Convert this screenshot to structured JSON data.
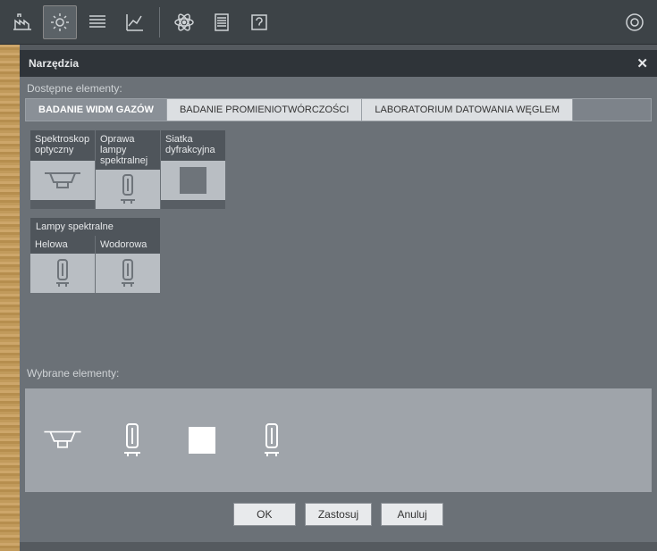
{
  "dialog": {
    "title": "Narzędzia",
    "available_label": "Dostępne elementy:",
    "selected_label": "Wybrane elementy:",
    "tabs": [
      "BADANIE WIDM GAZÓW",
      "BADANIE PROMIENIOTWÓRCZOŚCI",
      "LABORATORIUM DATOWANIA WĘGLEM"
    ],
    "main_items": [
      {
        "label": "Spektroskop optyczny",
        "icon": "spectroscope"
      },
      {
        "label": "Oprawa lampy spektralnej",
        "icon": "lamp-holder"
      },
      {
        "label": "Siatka dyfrakcyjna",
        "icon": "square"
      }
    ],
    "lamps_group_label": "Lampy spektralne",
    "lamp_items": [
      {
        "label": "Helowa",
        "icon": "lamp"
      },
      {
        "label": "Wodorowa",
        "icon": "lamp"
      }
    ],
    "selected": [
      "spectroscope",
      "lamp-holder",
      "square",
      "lamp"
    ],
    "buttons": {
      "ok": "OK",
      "apply": "Zastosuj",
      "cancel": "Anuluj"
    }
  }
}
